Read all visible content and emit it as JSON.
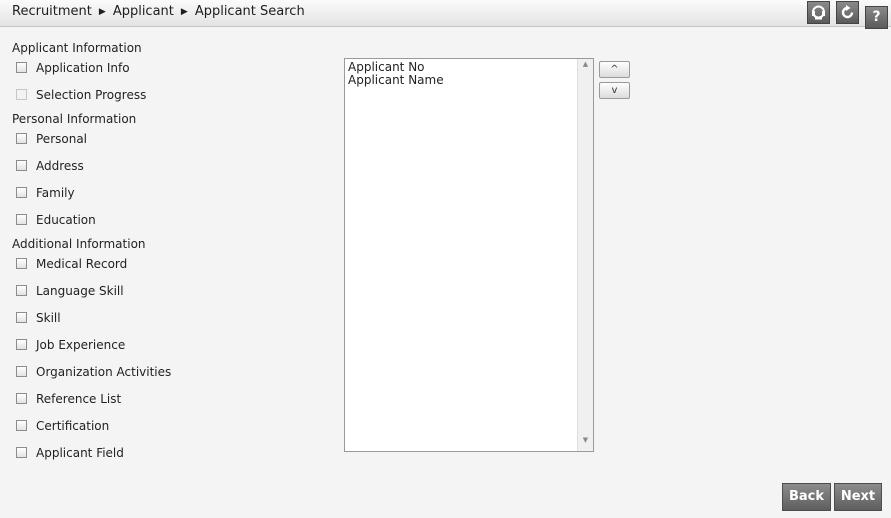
{
  "header": {
    "breadcrumb": [
      "Recruitment",
      "Applicant",
      "Applicant Search"
    ],
    "separator": "▶",
    "tools": {
      "support_icon": "headset-icon",
      "refresh_icon": "refresh-icon",
      "help_label": "?"
    }
  },
  "sections": [
    {
      "title": "Applicant Information",
      "items": [
        {
          "label": "Application Info",
          "checked": false,
          "enabled": true
        },
        {
          "label": "Selection Progress",
          "checked": false,
          "enabled": false
        }
      ]
    },
    {
      "title": "Personal Information",
      "items": [
        {
          "label": "Personal",
          "checked": false,
          "enabled": true
        },
        {
          "label": "Address",
          "checked": false,
          "enabled": true
        },
        {
          "label": "Family",
          "checked": false,
          "enabled": true
        },
        {
          "label": "Education",
          "checked": false,
          "enabled": true
        }
      ]
    },
    {
      "title": "Additional Information",
      "items": [
        {
          "label": "Medical Record",
          "checked": false,
          "enabled": true
        },
        {
          "label": "Language Skill",
          "checked": false,
          "enabled": true
        },
        {
          "label": "Skill",
          "checked": false,
          "enabled": true
        },
        {
          "label": "Job Experience",
          "checked": false,
          "enabled": true
        },
        {
          "label": "Organization Activities",
          "checked": false,
          "enabled": true
        },
        {
          "label": "Reference List",
          "checked": false,
          "enabled": true
        },
        {
          "label": "Certification",
          "checked": false,
          "enabled": true
        },
        {
          "label": "Applicant Field",
          "checked": false,
          "enabled": true
        }
      ]
    }
  ],
  "selected_fields": [
    "Applicant No",
    "Applicant Name"
  ],
  "move_buttons": {
    "up": "^",
    "down": "v"
  },
  "footer": {
    "back_label": "Back",
    "next_label": "Next"
  }
}
